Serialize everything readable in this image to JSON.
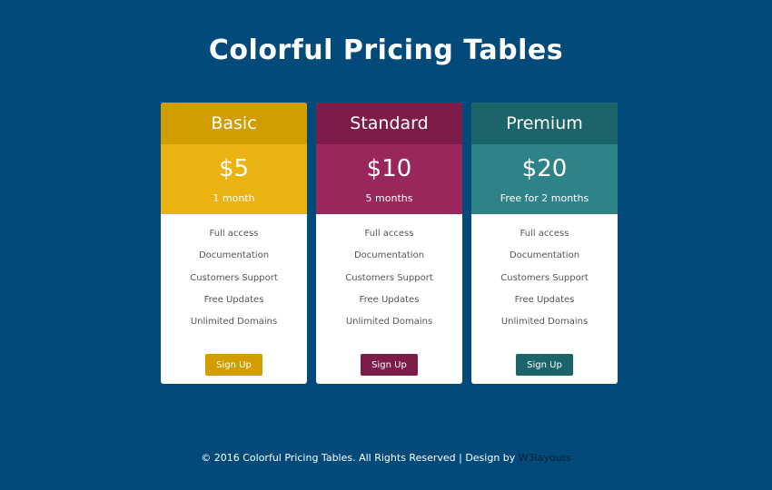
{
  "page": {
    "title": "Colorful Pricing Tables"
  },
  "plans": [
    {
      "name": "Basic",
      "price": "$5",
      "period": "1 month",
      "button_label": "Sign Up",
      "colors": {
        "header": "#d29d00",
        "price_bg": "#ebb312",
        "button": "#d29d00"
      }
    },
    {
      "name": "Standard",
      "price": "$10",
      "period": "5 months",
      "button_label": "Sign Up",
      "colors": {
        "header": "#7d1c49",
        "price_bg": "#99275c",
        "button": "#7d1c49"
      }
    },
    {
      "name": "Premium",
      "price": "$20",
      "period": "Free for 2 months",
      "button_label": "Sign Up",
      "colors": {
        "header": "#1b6469",
        "price_bg": "#2e8388",
        "button": "#1b6469"
      }
    }
  ],
  "features": [
    "Full access",
    "Documentation",
    "Customers Support",
    "Free Updates",
    "Unlimited Domains"
  ],
  "footer": {
    "text": "© 2016 Colorful Pricing Tables. All Rights Reserved | Design by ",
    "link": "W3layouts"
  },
  "colors": {
    "background": "#024a7a"
  }
}
